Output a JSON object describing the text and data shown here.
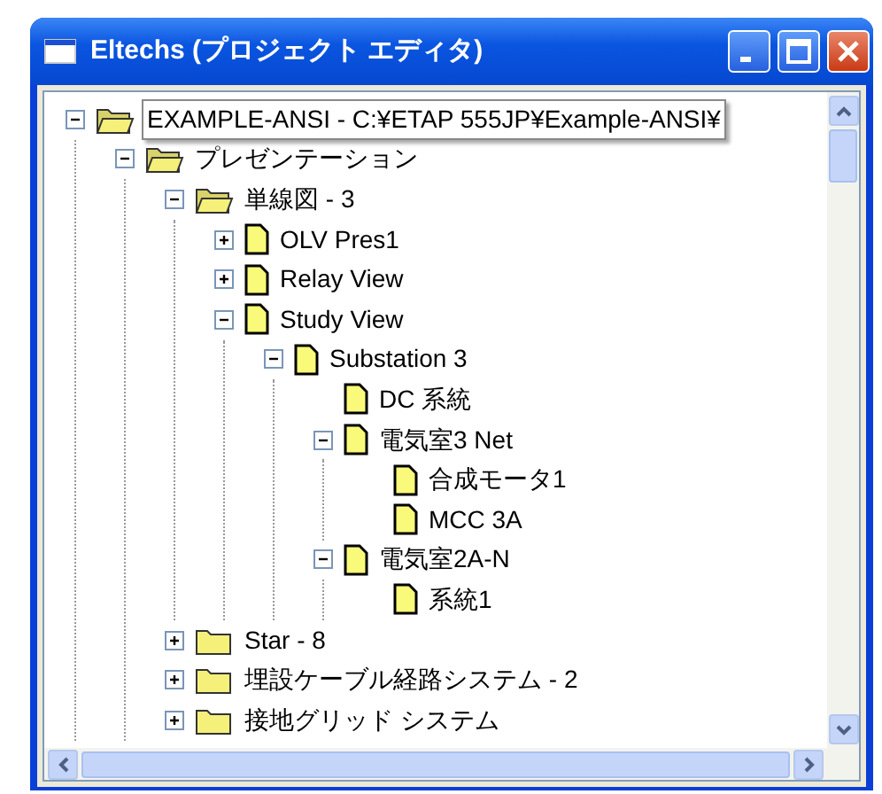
{
  "window": {
    "title": "Eltechs (プロジェクト エディタ)"
  },
  "tree": [
    {
      "label": "EXAMPLE-ANSI - C:¥ETAP 555JP¥Example-ANSI¥",
      "kind": "folder",
      "expanded": true,
      "tooltip": true,
      "children": [
        {
          "label": "プレゼンテーション",
          "kind": "folder",
          "expanded": true,
          "children": [
            {
              "label": "単線図 - 3",
              "kind": "folder",
              "expanded": true,
              "children": [
                {
                  "label": "OLV Pres1",
                  "kind": "view",
                  "expanded": false
                },
                {
                  "label": "Relay View",
                  "kind": "view",
                  "expanded": false
                },
                {
                  "label": "Study View",
                  "kind": "view",
                  "expanded": true,
                  "children": [
                    {
                      "label": "Substation 3",
                      "kind": "view",
                      "expanded": true,
                      "children": [
                        {
                          "label": "DC 系統",
                          "kind": "view"
                        },
                        {
                          "label": "電気室3 Net",
                          "kind": "view",
                          "expanded": true,
                          "children": [
                            {
                              "label": "合成モータ1",
                              "kind": "view"
                            },
                            {
                              "label": "MCC 3A",
                              "kind": "view"
                            }
                          ]
                        },
                        {
                          "label": "電気室2A-N",
                          "kind": "view",
                          "expanded": true,
                          "children": [
                            {
                              "label": "系統1",
                              "kind": "view"
                            }
                          ]
                        }
                      ]
                    }
                  ]
                }
              ]
            },
            {
              "label": "Star - 8",
              "kind": "folder",
              "expanded": false
            },
            {
              "label": "埋設ケーブル経路システム - 2",
              "kind": "folder",
              "expanded": false
            },
            {
              "label": "接地グリッド システム",
              "kind": "folder",
              "expanded": false
            }
          ]
        }
      ]
    }
  ]
}
